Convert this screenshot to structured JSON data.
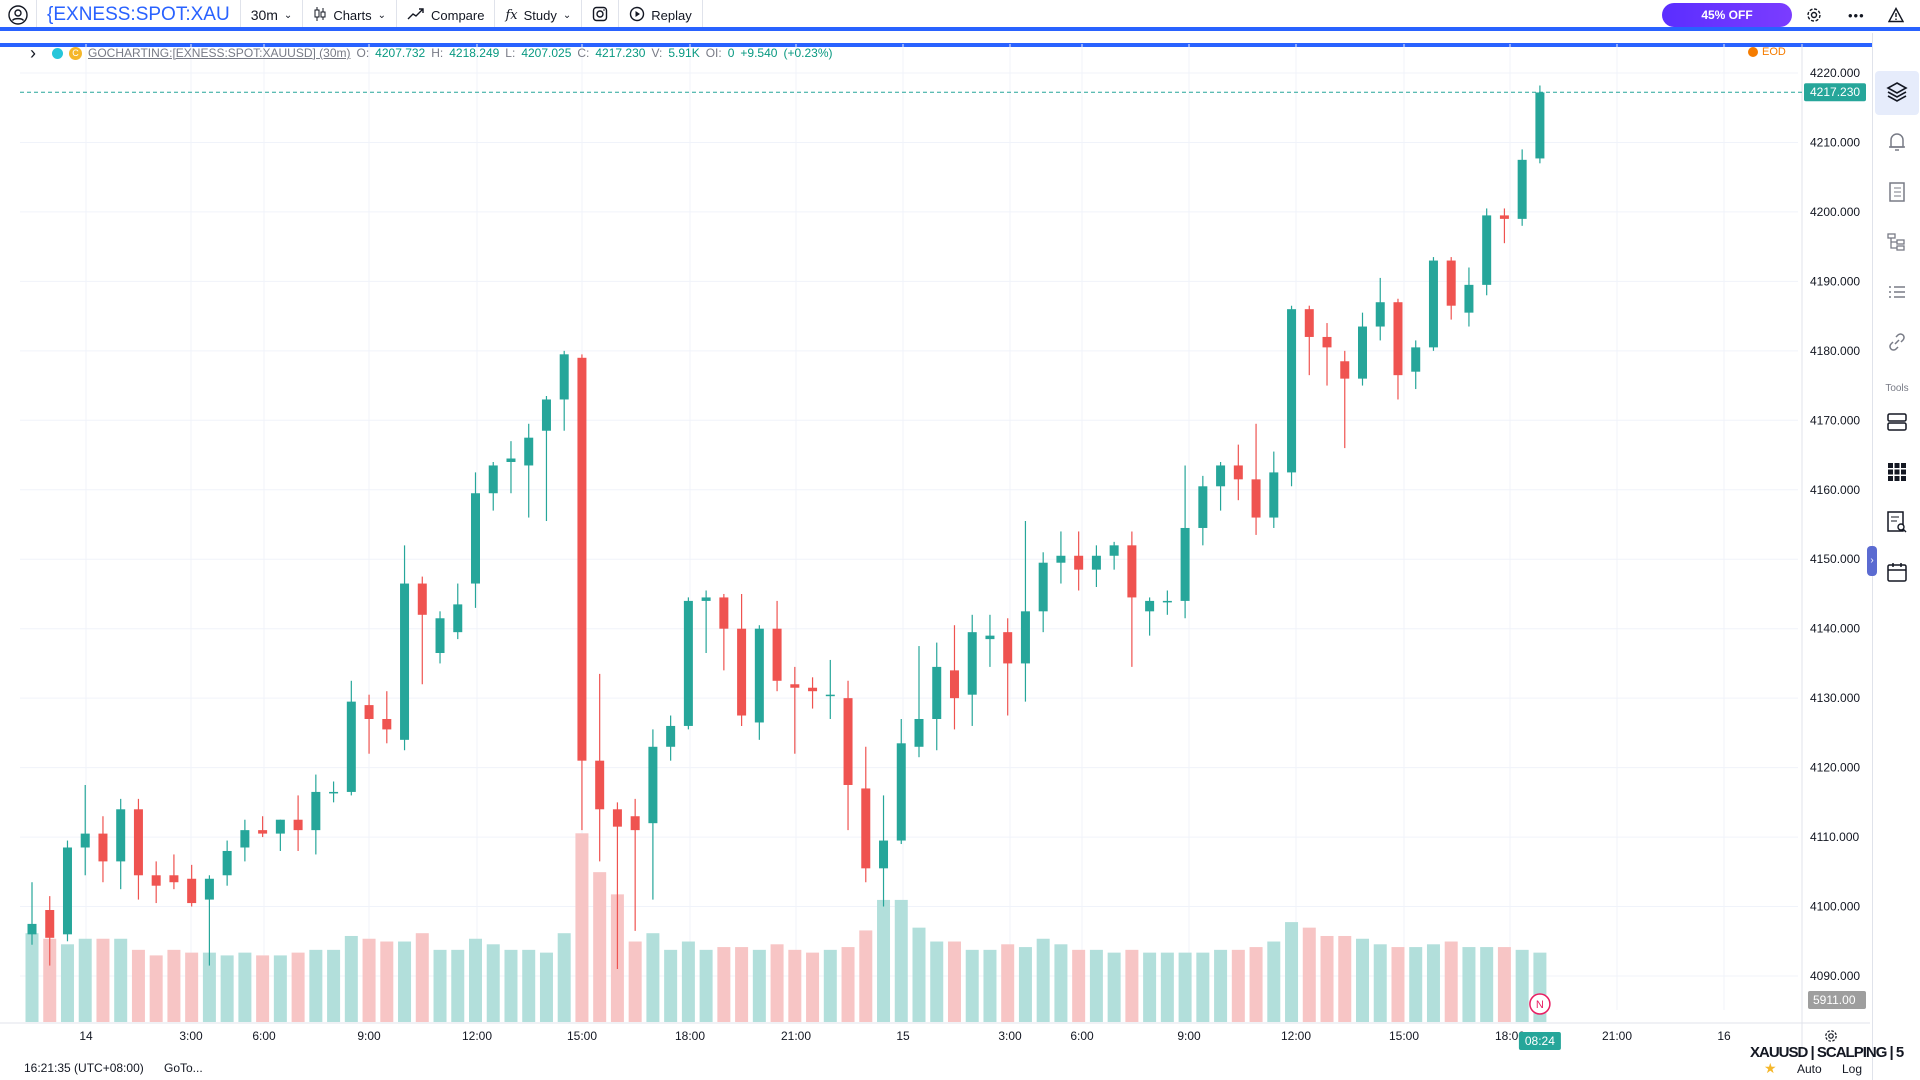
{
  "topbar": {
    "symbol": "{EXNESS:SPOT:XAU",
    "interval": "30m",
    "charts": "Charts",
    "compare": "Compare",
    "study": "Study",
    "replay": "Replay",
    "promo": "45% OFF"
  },
  "legend": {
    "source": "GOCHARTING:[EXNESS:SPOT:XAUUSD] (30m)",
    "o_label": "O:",
    "o": "4207.732",
    "h_label": "H:",
    "h": "4218.249",
    "l_label": "L:",
    "l": "4207.025",
    "c_label": "C:",
    "c": "4217.230",
    "v_label": "V:",
    "v": "5.91K",
    "oi_label": "OI:",
    "oi": "0",
    "change": "+9.540",
    "change_pct": "(+0.23%)",
    "eod": "EOD"
  },
  "price_axis": {
    "ticks": [
      "4220.000",
      "4210.000",
      "4200.000",
      "4190.000",
      "4180.000",
      "4170.000",
      "4160.000",
      "4150.000",
      "4140.000",
      "4130.000",
      "4120.000",
      "4110.000",
      "4100.000",
      "4090.000"
    ],
    "last_price": "4217.230",
    "last_volume": "5911.00"
  },
  "time_axis": {
    "ticks": [
      "14",
      "3:00",
      "6:00",
      "9:00",
      "12:00",
      "15:00",
      "18:00",
      "21:00",
      "15",
      "3:00",
      "6:00",
      "9:00",
      "12:00",
      "15:00",
      "18:00",
      "21:00",
      "16"
    ],
    "current_time": "08:24"
  },
  "news_marker": "N",
  "rightbar": {
    "tools_label": "Tools"
  },
  "bottombar": {
    "clock": "16:21:35 (UTC+08:00)",
    "goto": "GoTo...",
    "watermark": "XAUUSD | SCALPING | 5",
    "auto": "Auto",
    "log": "Log"
  },
  "colors": {
    "up": "#26a69a",
    "down": "#ef5350",
    "accent": "#2962ff"
  },
  "chart_data": {
    "type": "candlestick",
    "ylim": [
      4085,
      4222
    ],
    "interval": "30m",
    "candles": [
      [
        4096.0,
        4103.5,
        4094.5,
        4097.5,
        1600
      ],
      [
        4099.5,
        4101.5,
        4091.5,
        4095.5,
        1500
      ],
      [
        4096.0,
        4109.5,
        4095.0,
        4108.5,
        1400
      ],
      [
        4108.5,
        4117.5,
        4104.5,
        4110.5,
        1500
      ],
      [
        4110.5,
        4113.0,
        4103.5,
        4106.5,
        1500
      ],
      [
        4106.5,
        4115.5,
        4102.5,
        4114.0,
        1500
      ],
      [
        4114.0,
        4115.5,
        4101.0,
        4104.5,
        1300
      ],
      [
        4104.5,
        4106.5,
        4100.5,
        4103.0,
        1200
      ],
      [
        4104.5,
        4107.5,
        4102.5,
        4103.5,
        1300
      ],
      [
        4104.0,
        4106.0,
        4100.0,
        4100.5,
        1250
      ],
      [
        4101.0,
        4104.5,
        4091.5,
        4104.0,
        1250
      ],
      [
        4104.5,
        4109.5,
        4103.0,
        4108.0,
        1200
      ],
      [
        4108.5,
        4112.5,
        4106.5,
        4111.0,
        1250
      ],
      [
        4111.0,
        4113.0,
        4110.0,
        4110.5,
        1200
      ],
      [
        4110.5,
        4112.5,
        4108.0,
        4112.5,
        1200
      ],
      [
        4112.5,
        4116.0,
        4108.0,
        4111.0,
        1250
      ],
      [
        4111.0,
        4119.0,
        4107.5,
        4116.5,
        1300
      ],
      [
        4116.5,
        4118.0,
        4115.0,
        4116.5,
        1300
      ],
      [
        4116.5,
        4132.5,
        4116.0,
        4129.5,
        1550
      ],
      [
        4129.0,
        4130.5,
        4122.0,
        4127.0,
        1500
      ],
      [
        4127.0,
        4131.0,
        4123.5,
        4125.5,
        1450
      ],
      [
        4124.0,
        4152.0,
        4122.5,
        4146.5,
        1450
      ],
      [
        4146.5,
        4147.5,
        4132.0,
        4142.0,
        1600
      ],
      [
        4136.5,
        4142.5,
        4135.0,
        4141.5,
        1300
      ],
      [
        4139.5,
        4146.5,
        4138.5,
        4143.5,
        1300
      ],
      [
        4146.5,
        4162.5,
        4143.0,
        4159.5,
        1500
      ],
      [
        4159.5,
        4164.0,
        4157.0,
        4163.5,
        1400
      ],
      [
        4164.0,
        4167.0,
        4159.5,
        4164.5,
        1300
      ],
      [
        4163.5,
        4169.5,
        4156.0,
        4167.5,
        1300
      ],
      [
        4168.5,
        4173.5,
        4155.5,
        4173.0,
        1250
      ],
      [
        4173.0,
        4180.0,
        4168.5,
        4179.5,
        1600
      ],
      [
        4179.0,
        4179.5,
        4111.0,
        4121.0,
        3400
      ],
      [
        4121.0,
        4133.5,
        4106.5,
        4114.0,
        2700
      ],
      [
        4114.0,
        4115.0,
        4091.0,
        4111.5,
        2300
      ],
      [
        4113.0,
        4115.5,
        4096.5,
        4111.0,
        1450
      ],
      [
        4112.0,
        4125.5,
        4101.0,
        4123.0,
        1600
      ],
      [
        4123.0,
        4127.5,
        4121.0,
        4126.0,
        1300
      ],
      [
        4126.0,
        4144.5,
        4125.5,
        4144.0,
        1450
      ],
      [
        4144.0,
        4145.5,
        4136.5,
        4144.5,
        1300
      ],
      [
        4144.5,
        4145.0,
        4134.0,
        4140.0,
        1350
      ],
      [
        4140.0,
        4145.0,
        4126.0,
        4127.5,
        1350
      ],
      [
        4126.5,
        4140.5,
        4124.0,
        4140.0,
        1300
      ],
      [
        4140.0,
        4144.0,
        4131.0,
        4132.5,
        1400
      ],
      [
        4132.0,
        4134.5,
        4122.0,
        4131.5,
        1300
      ],
      [
        4131.5,
        4133.0,
        4128.5,
        4131.0,
        1250
      ],
      [
        4130.5,
        4135.5,
        4127.0,
        4130.5,
        1300
      ],
      [
        4130.0,
        4132.5,
        4111.0,
        4117.5,
        1350
      ],
      [
        4117.0,
        4123.0,
        4103.5,
        4105.5,
        1650
      ],
      [
        4105.5,
        4116.0,
        4100.0,
        4109.5,
        2200
      ],
      [
        4109.5,
        4127.0,
        4109.0,
        4123.5,
        2200
      ],
      [
        4123.0,
        4137.5,
        4121.5,
        4127.0,
        1700
      ],
      [
        4127.0,
        4138.0,
        4122.5,
        4134.5,
        1450
      ],
      [
        4134.0,
        4140.5,
        4125.5,
        4130.0,
        1450
      ],
      [
        4130.5,
        4142.0,
        4126.0,
        4139.5,
        1300
      ],
      [
        4138.5,
        4142.0,
        4134.5,
        4139.0,
        1300
      ],
      [
        4139.5,
        4141.5,
        4127.5,
        4135.0,
        1400
      ],
      [
        4135.0,
        4155.5,
        4129.5,
        4142.5,
        1350
      ],
      [
        4142.5,
        4151.0,
        4139.5,
        4149.5,
        1500
      ],
      [
        4149.5,
        4154.0,
        4146.5,
        4150.5,
        1400
      ],
      [
        4150.5,
        4154.0,
        4145.5,
        4148.5,
        1300
      ],
      [
        4148.5,
        4152.0,
        4146.0,
        4150.5,
        1300
      ],
      [
        4150.5,
        4152.5,
        4148.5,
        4152.0,
        1250
      ],
      [
        4152.0,
        4154.0,
        4134.5,
        4144.5,
        1300
      ],
      [
        4142.5,
        4144.5,
        4139.0,
        4144.0,
        1250
      ],
      [
        4144.0,
        4145.5,
        4142.0,
        4144.0,
        1250
      ],
      [
        4144.0,
        4163.5,
        4141.5,
        4154.5,
        1250
      ],
      [
        4154.5,
        4162.0,
        4152.0,
        4160.5,
        1250
      ],
      [
        4160.5,
        4164.0,
        4157.0,
        4163.5,
        1300
      ],
      [
        4163.5,
        4166.5,
        4158.5,
        4161.5,
        1300
      ],
      [
        4161.5,
        4169.5,
        4153.5,
        4156.0,
        1350
      ],
      [
        4156.0,
        4165.5,
        4154.5,
        4162.5,
        1450
      ],
      [
        4162.5,
        4186.5,
        4160.5,
        4186.0,
        1800
      ],
      [
        4186.0,
        4186.5,
        4176.5,
        4182.0,
        1700
      ],
      [
        4182.0,
        4184.0,
        4175.0,
        4180.5,
        1550
      ],
      [
        4178.5,
        4180.0,
        4166.0,
        4176.0,
        1550
      ],
      [
        4176.0,
        4185.5,
        4175.0,
        4183.5,
        1500
      ],
      [
        4183.5,
        4190.5,
        4181.5,
        4187.0,
        1400
      ],
      [
        4187.0,
        4187.5,
        4173.0,
        4176.5,
        1350
      ],
      [
        4177.0,
        4181.5,
        4174.5,
        4180.5,
        1350
      ],
      [
        4180.5,
        4193.5,
        4180.0,
        4193.0,
        1400
      ],
      [
        4193.0,
        4193.5,
        4184.5,
        4186.5,
        1450
      ],
      [
        4185.5,
        4192.0,
        4183.5,
        4189.5,
        1350
      ],
      [
        4189.5,
        4200.5,
        4188.0,
        4199.5,
        1350
      ],
      [
        4199.5,
        4200.5,
        4195.5,
        4199.0,
        1350
      ],
      [
        4199.0,
        4209.0,
        4198.0,
        4207.5,
        1300
      ],
      [
        4207.7,
        4218.2,
        4207.0,
        4217.2,
        1250
      ]
    ]
  }
}
